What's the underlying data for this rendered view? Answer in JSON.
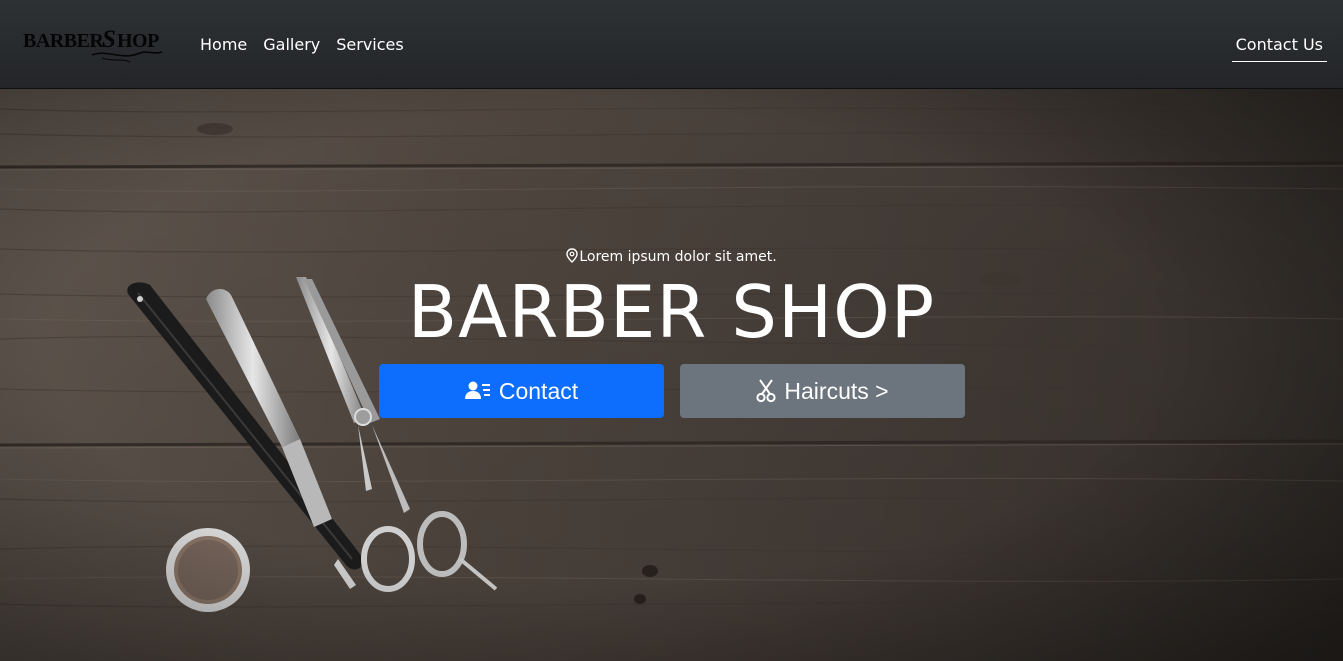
{
  "navbar": {
    "logo_alt": "BarberShop",
    "links": [
      {
        "label": "Home"
      },
      {
        "label": "Gallery"
      },
      {
        "label": "Services"
      }
    ],
    "contact_label": "Contact Us"
  },
  "hero": {
    "location_icon": "map-pin-icon",
    "location_text": "Lorem ipsum dolor sit amet.",
    "title": "BARBER SHOP",
    "buttons": {
      "contact": {
        "label": "Contact",
        "icon": "user-list-icon"
      },
      "haircuts": {
        "label": "Haircuts >",
        "icon": "scissors-icon"
      }
    }
  },
  "colors": {
    "navbar_bg": "#2b2e31",
    "primary": "#0d6efd",
    "secondary": "#6c757d",
    "text": "#ffffff",
    "wood": "#5b5048"
  }
}
